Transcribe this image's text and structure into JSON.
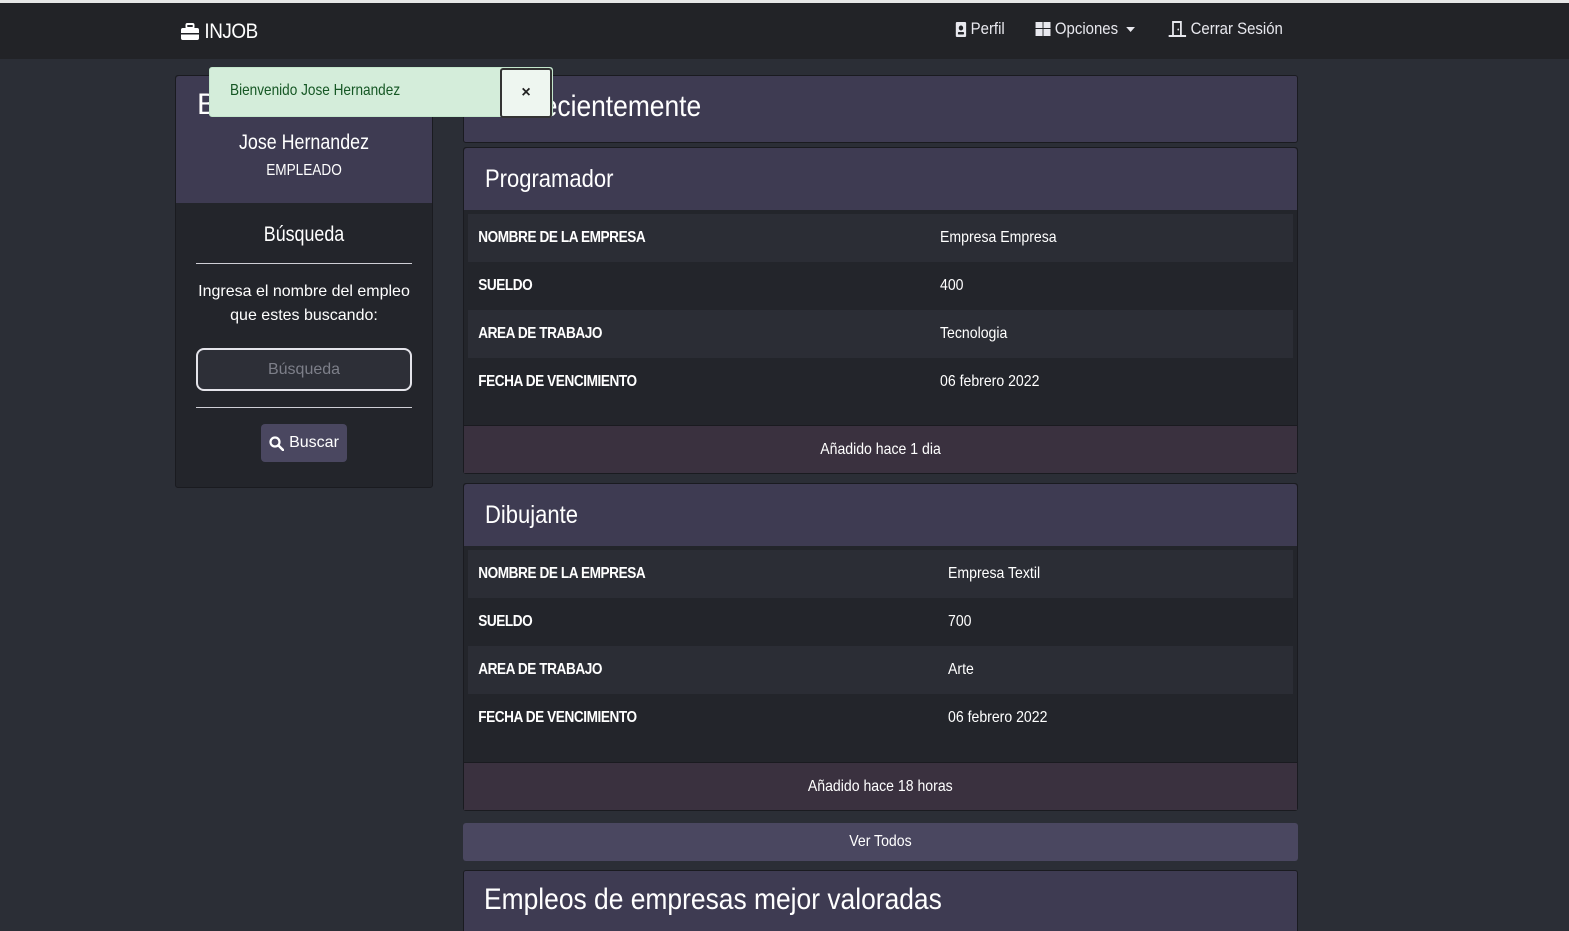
{
  "navbar": {
    "brand": "INJOB",
    "brand_icon": "briefcase-icon",
    "items": [
      {
        "label": "Perfil",
        "icon": "id-card-icon"
      },
      {
        "label": "Opciones",
        "icon": "grid-icon"
      },
      {
        "label": "Cerrar Sesión",
        "icon": "door-exit-icon"
      }
    ]
  },
  "alert": {
    "message": "Bienvenido Jose Hernandez",
    "close": "×"
  },
  "sidebar": {
    "heading_letter": "B",
    "user_name": "Jose Hernandez",
    "user_role": "EMPLEADO",
    "search_title": "Búsqueda",
    "search_description": "Ingresa el nombre del empleo que estes buscando:",
    "search_placeholder": "Búsqueda",
    "search_button": "Buscar"
  },
  "main": {
    "title_visible": "dos recientemente",
    "jobs": [
      {
        "title": "Programador",
        "rows": [
          {
            "key": "NOMBRE DE LA EMPRESA",
            "value": "Empresa Empresa"
          },
          {
            "key": "SUELDO",
            "value": "400"
          },
          {
            "key": "AREA DE TRABAJO",
            "value": "Tecnologia"
          },
          {
            "key": "FECHA DE VENCIMIENTO",
            "value": "06 febrero 2022"
          }
        ],
        "footer": "Añadido hace 1 dia"
      },
      {
        "title": "Dibujante",
        "rows": [
          {
            "key": "NOMBRE DE LA EMPRESA",
            "value": "Empresa Textil"
          },
          {
            "key": "SUELDO",
            "value": "700"
          },
          {
            "key": "AREA DE TRABAJO",
            "value": "Arte"
          },
          {
            "key": "FECHA DE VENCIMIENTO",
            "value": "06 febrero 2022"
          }
        ],
        "footer": "Añadido hace 18 horas"
      }
    ],
    "view_all": "Ver Todos",
    "section2_title": "Empleos de empresas mejor valoradas"
  },
  "colors": {
    "navbar": "#222327",
    "page_bg": "#2b2e36",
    "panel_header": "#3e3b52",
    "accent_button": "#4a4760",
    "alert_bg": "#d4edda",
    "alert_text": "#155724"
  }
}
